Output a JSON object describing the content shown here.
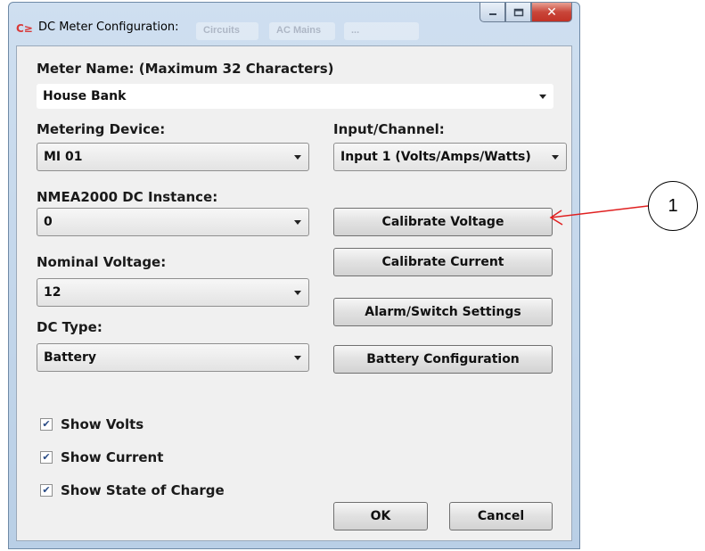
{
  "window": {
    "title": "DC Meter Configuration:",
    "app_icon_text": "C≥",
    "background_tabs": [
      "Circuits",
      "AC Mains",
      "...",
      ""
    ]
  },
  "meter_name": {
    "label": "Meter Name: (Maximum 32 Characters)",
    "value": "House Bank"
  },
  "metering_device": {
    "label": "Metering Device:",
    "value": "MI 01"
  },
  "input_channel": {
    "label": "Input/Channel:",
    "value": "Input 1 (Volts/Amps/Watts)"
  },
  "nmea_instance": {
    "label": "NMEA2000 DC Instance:",
    "value": "0"
  },
  "nominal_voltage": {
    "label": "Nominal Voltage:",
    "value": "12"
  },
  "dc_type": {
    "label": "DC Type:",
    "value": "Battery"
  },
  "buttons": {
    "calibrate_voltage": "Calibrate Voltage",
    "calibrate_current": "Calibrate Current",
    "alarm_switch": "Alarm/Switch Settings",
    "battery_config": "Battery Configuration",
    "ok": "OK",
    "cancel": "Cancel"
  },
  "checkboxes": [
    {
      "label": "Show Volts",
      "checked": true
    },
    {
      "label": "Show Current",
      "checked": true
    },
    {
      "label": "Show State of Charge",
      "checked": true
    }
  ],
  "annotation": {
    "number": "1",
    "color": "#e02020"
  }
}
